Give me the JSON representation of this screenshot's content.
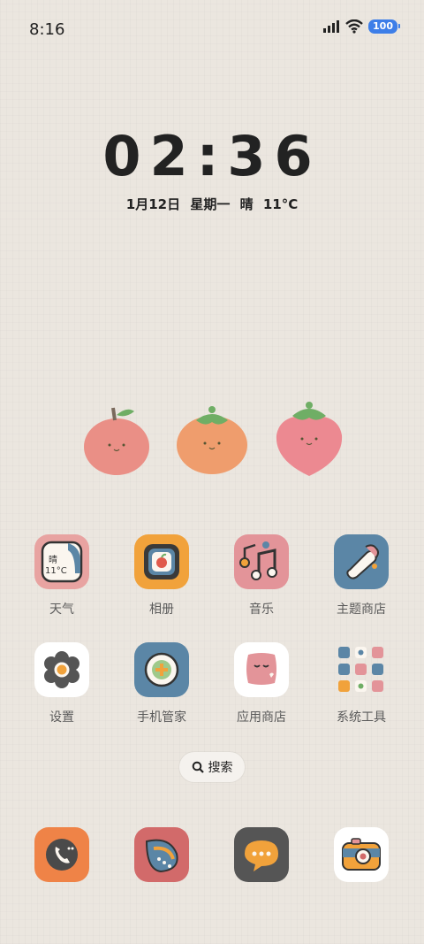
{
  "status": {
    "time": "8:16",
    "battery": "100"
  },
  "clock": {
    "time": "02:36",
    "date": "1月12日",
    "weekday": "星期一",
    "weather": "晴",
    "temp": "11°C"
  },
  "weather_icon": {
    "condition": "晴",
    "temp": "11°C"
  },
  "apps_row1": [
    {
      "label": "天气",
      "icon": "weather-icon",
      "color": "#e8a3a1"
    },
    {
      "label": "相册",
      "icon": "album-icon",
      "color": "#f1a23b"
    },
    {
      "label": "音乐",
      "icon": "music-icon",
      "color": "#e39499"
    },
    {
      "label": "主题商店",
      "icon": "theme-store-icon",
      "color": "#5b86a6"
    }
  ],
  "apps_row2": [
    {
      "label": "设置",
      "icon": "settings-icon",
      "color": "#ffffff"
    },
    {
      "label": "手机管家",
      "icon": "phone-manager-icon",
      "color": "#5b86a6"
    },
    {
      "label": "应用商店",
      "icon": "app-store-icon",
      "color": "#ffffff"
    },
    {
      "label": "系统工具",
      "icon": "system-tools-folder-icon",
      "color": "transparent"
    }
  ],
  "search": {
    "label": "搜索"
  },
  "dock": [
    {
      "icon": "phone-icon",
      "color": "#ef8347"
    },
    {
      "icon": "contacts-icon",
      "color": "#d26a6a"
    },
    {
      "icon": "messages-icon",
      "color": "#555555"
    },
    {
      "icon": "camera-icon",
      "color": "#ffffff"
    }
  ]
}
